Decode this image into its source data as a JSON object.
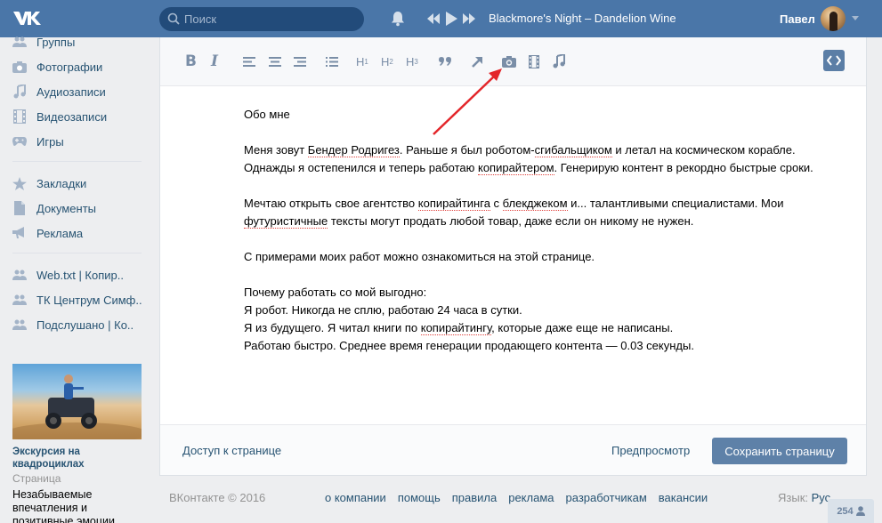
{
  "header": {
    "search_placeholder": "Поиск",
    "now_playing": "Blackmore's Night – Dandelion Wine",
    "user_name": "Павел"
  },
  "sidebar": {
    "items": [
      {
        "label": "Группы",
        "icon": "groups-icon"
      },
      {
        "label": "Фотографии",
        "icon": "camera-icon"
      },
      {
        "label": "Аудиозаписи",
        "icon": "music-note-icon"
      },
      {
        "label": "Видеозаписи",
        "icon": "film-icon"
      },
      {
        "label": "Игры",
        "icon": "gamepad-icon"
      },
      {
        "label": "Закладки",
        "icon": "star-icon"
      },
      {
        "label": "Документы",
        "icon": "document-icon"
      },
      {
        "label": "Реклама",
        "icon": "megaphone-icon"
      },
      {
        "label": "Web.txt | Копир..",
        "icon": "groups-icon"
      },
      {
        "label": "ТК Центрум Симф..",
        "icon": "groups-icon"
      },
      {
        "label": "Подслушано | Ко..",
        "icon": "groups-icon"
      }
    ],
    "ad": {
      "title": "Экскурсия на квадроциклах",
      "type": "Страница",
      "description": "Незабываемые впечатления и позитивные эмоции"
    }
  },
  "editor": {
    "toolbar": {
      "bold": "B",
      "italic": "I",
      "h1": "H",
      "h1_sub": "1",
      "h2": "H",
      "h2_sub": "2",
      "h3": "H",
      "h3_sub": "3"
    },
    "content": {
      "heading": "Обо мне",
      "p1_parts": [
        "Меня зовут ",
        "Бендер Родригез",
        ". Раньше я был роботом-",
        "сгибальщиком",
        " и летал на космическом корабле. Однажды я остепенился и теперь работаю ",
        "копирайтером",
        ". Генерирую контент в рекордно быстрые сроки."
      ],
      "p2_parts": [
        "Мечтаю открыть свое агентство ",
        "копирайтинга",
        " с ",
        "блекджеком",
        " и... талантливыми специалистами. Мои ",
        "футуристичные",
        " тексты могут продать любой товар, даже если он никому не нужен."
      ],
      "p3": "С примерами моих работ можно ознакомиться на этой странице.",
      "p4_line1": "Почему работать со мой выгодно:",
      "p4_line2": "Я робот. Никогда не сплю, работаю 24 часа в сутки.",
      "p4_line3_parts": [
        "Я из будущего. Я читал книги по ",
        "копирайтингу",
        ", которые даже еще не написаны."
      ],
      "p4_line4": "Работаю быстро. Среднее время генерации продающего контента — 0.03 секунды."
    },
    "footer": {
      "access_label": "Доступ к странице",
      "preview_label": "Предпросмотр",
      "save_label": "Сохранить страницу"
    }
  },
  "page_footer": {
    "copyright": "ВКонтакте © 2016",
    "links": [
      "о компании",
      "помощь",
      "правила",
      "реклама",
      "разработчикам",
      "вакансии"
    ],
    "language_label": "Язык:",
    "language_value": "Рус"
  },
  "online_count": "254",
  "colors": {
    "header": "#4a76a8",
    "link": "#285473",
    "button": "#5e81a8",
    "annotation_arrow": "#e3262a"
  }
}
